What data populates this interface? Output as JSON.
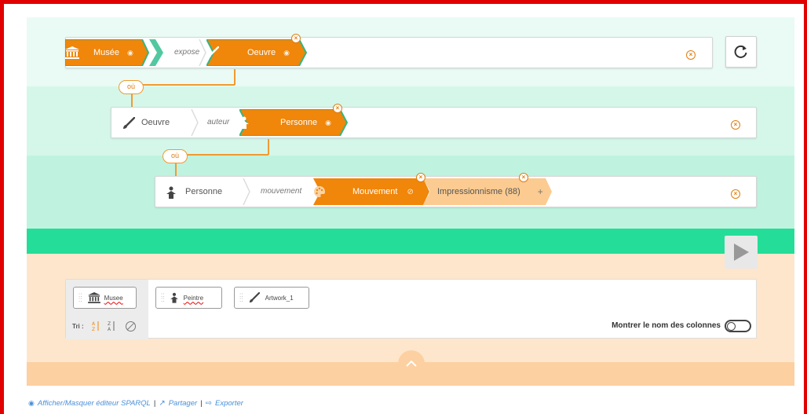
{
  "rows": [
    {
      "subject": {
        "label": "Musée",
        "icon": "museum-icon"
      },
      "property": "expose",
      "object": {
        "label": "Oeuvre",
        "icon": "paintbrush-icon"
      }
    },
    {
      "subject": {
        "label": "Oeuvre",
        "icon": "paintbrush-icon"
      },
      "property": "auteur",
      "object": {
        "label": "Personne",
        "icon": "person-icon"
      }
    },
    {
      "subject": {
        "label": "Personne",
        "icon": "person-icon"
      },
      "property": "mouvement",
      "object": {
        "label": "Mouvement",
        "icon": "palette-icon"
      },
      "value": {
        "label": "Impressionnisme (88)"
      },
      "add_label": "+"
    }
  ],
  "connector_label": "où",
  "selection": {
    "variables": [
      {
        "label": "Musee",
        "icon": "museum-icon"
      },
      {
        "label": "Peintre",
        "icon": "person-icon"
      },
      {
        "label": "Artwork_1",
        "icon": "paintbrush-icon"
      }
    ],
    "sort_label": "Tri :",
    "show_columns_label": "Montrer le nom des colonnes"
  },
  "footer": {
    "sparql_toggle": "Afficher/Masquer éditeur SPARQL",
    "share": "Partager",
    "export": "Exporter",
    "separator": "|"
  },
  "colors": {
    "accent_orange": "#f0860a",
    "light_orange": "#fbcb91",
    "green": "#24dd98",
    "chevron_teal": "#52c8a0",
    "frame_red": "#e00000"
  }
}
